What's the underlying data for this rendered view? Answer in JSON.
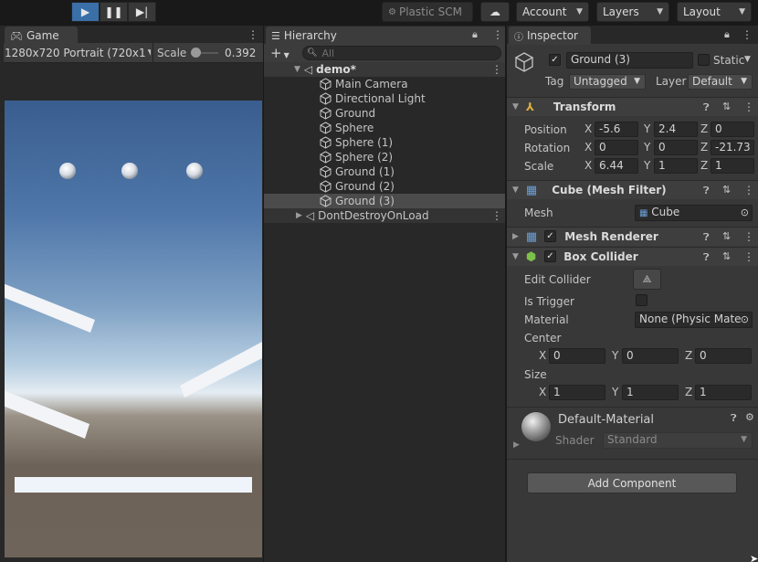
{
  "toolbar": {
    "plastic_label": "Plastic SCM",
    "account_label": "Account",
    "layers_label": "Layers",
    "layout_label": "Layout"
  },
  "game": {
    "tab_label": "Game",
    "resolution": "1280x720 Portrait (720x1",
    "scale_label": "Scale",
    "scale_value": "0.392"
  },
  "hierarchy": {
    "tab_label": "Hierarchy",
    "search_placeholder": "All",
    "scene_name": "demo*",
    "items": [
      "Main Camera",
      "Directional Light",
      "Ground",
      "Sphere",
      "Sphere (1)",
      "Sphere (2)",
      "Ground (1)",
      "Ground (2)",
      "Ground (3)"
    ],
    "dont_destroy": "DontDestroyOnLoad"
  },
  "inspector": {
    "tab_label": "Inspector",
    "object_name": "Ground (3)",
    "static_label": "Static",
    "tag_label": "Tag",
    "tag_value": "Untagged",
    "layer_label": "Layer",
    "layer_value": "Default",
    "transform": {
      "title": "Transform",
      "position_label": "Position",
      "rotation_label": "Rotation",
      "scale_label": "Scale",
      "position": {
        "x": "-5.6",
        "y": "2.4",
        "z": "0"
      },
      "rotation": {
        "x": "0",
        "y": "0",
        "z": "-21.73"
      },
      "scale": {
        "x": "6.44",
        "y": "1",
        "z": "1"
      }
    },
    "mesh_filter": {
      "title": "Cube (Mesh Filter)",
      "mesh_label": "Mesh",
      "mesh_value": "Cube"
    },
    "mesh_renderer": {
      "title": "Mesh Renderer"
    },
    "box_collider": {
      "title": "Box Collider",
      "edit_label": "Edit Collider",
      "trigger_label": "Is Trigger",
      "material_label": "Material",
      "material_value": "None (Physic Mater",
      "center_label": "Center",
      "size_label": "Size",
      "center": {
        "x": "0",
        "y": "0",
        "z": "0"
      },
      "size": {
        "x": "1",
        "y": "1",
        "z": "1"
      }
    },
    "material": {
      "name": "Default-Material",
      "shader_label": "Shader",
      "shader_value": "Standard"
    },
    "add_component_label": "Add Component"
  },
  "axis_labels": {
    "x": "X",
    "y": "Y",
    "z": "Z"
  },
  "colors": {
    "accent": "#3a6fa8",
    "panel": "#383838",
    "selected_row": "#4b4b4b"
  }
}
